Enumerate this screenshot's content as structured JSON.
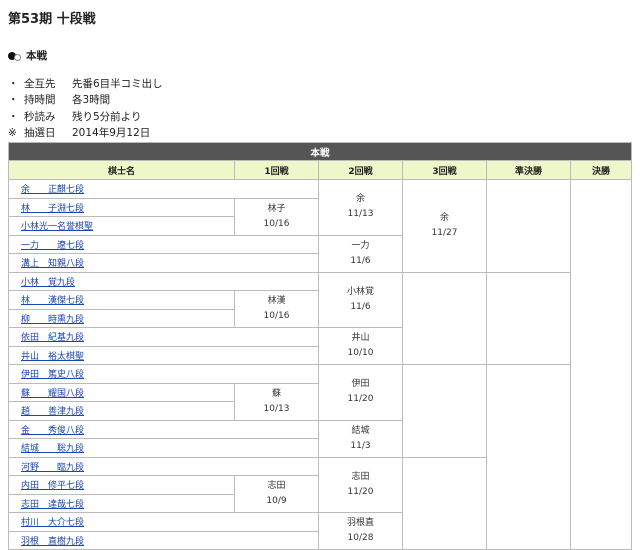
{
  "page_title": "第53期 十段戦",
  "section_title": "本戦",
  "rules": [
    {
      "mark": "・",
      "key": "全互先",
      "value": "先番6目半コミ出し"
    },
    {
      "mark": "・",
      "key": "持時間",
      "value": "各3時間"
    },
    {
      "mark": "・",
      "key": "秒読み",
      "value": "残り5分前より"
    },
    {
      "mark": "※",
      "key": "抽選日",
      "value": "2014年9月12日"
    }
  ],
  "bracket": {
    "title": "本戦",
    "columns": [
      "棋士名",
      "1回戦",
      "2回戦",
      "3回戦",
      "準決勝",
      "決勝"
    ],
    "players": [
      "余　　正麒七段",
      "林　　子淵七段",
      "小林光一名誉棋聖",
      "一力　　遼七段",
      "溝上　知親八段",
      "小林　覚九段",
      "林　　漢傑七段",
      "柳　　時熏九段",
      "依田　紀基九段",
      "井山　裕太棋聖",
      "伊田　篤史八段",
      "蘇　　耀国八段",
      "趙　　善津九段",
      "金　　秀俊八段",
      "結城　　聡九段",
      "河野　　臨九段",
      "内田　修平七段",
      "志田　達哉七段",
      "村川　大介七段",
      "羽根　直樹九段"
    ],
    "r1": [
      {
        "name": "林子",
        "date": "10/16"
      },
      {
        "name": "林漢",
        "date": "10/16"
      },
      {
        "name": "蘇",
        "date": "10/13"
      },
      {
        "name": "志田",
        "date": "10/9"
      }
    ],
    "r2": [
      {
        "name": "余",
        "date": "11/13"
      },
      {
        "name": "一力",
        "date": "11/6"
      },
      {
        "name": "小林覚",
        "date": "11/6"
      },
      {
        "name": "井山",
        "date": "10/10"
      },
      {
        "name": "伊田",
        "date": "11/20"
      },
      {
        "name": "結城",
        "date": "11/3"
      },
      {
        "name": "志田",
        "date": "11/20"
      },
      {
        "name": "羽根直",
        "date": "10/28"
      }
    ],
    "r3": [
      {
        "name": "余",
        "date": "11/27"
      }
    ]
  }
}
